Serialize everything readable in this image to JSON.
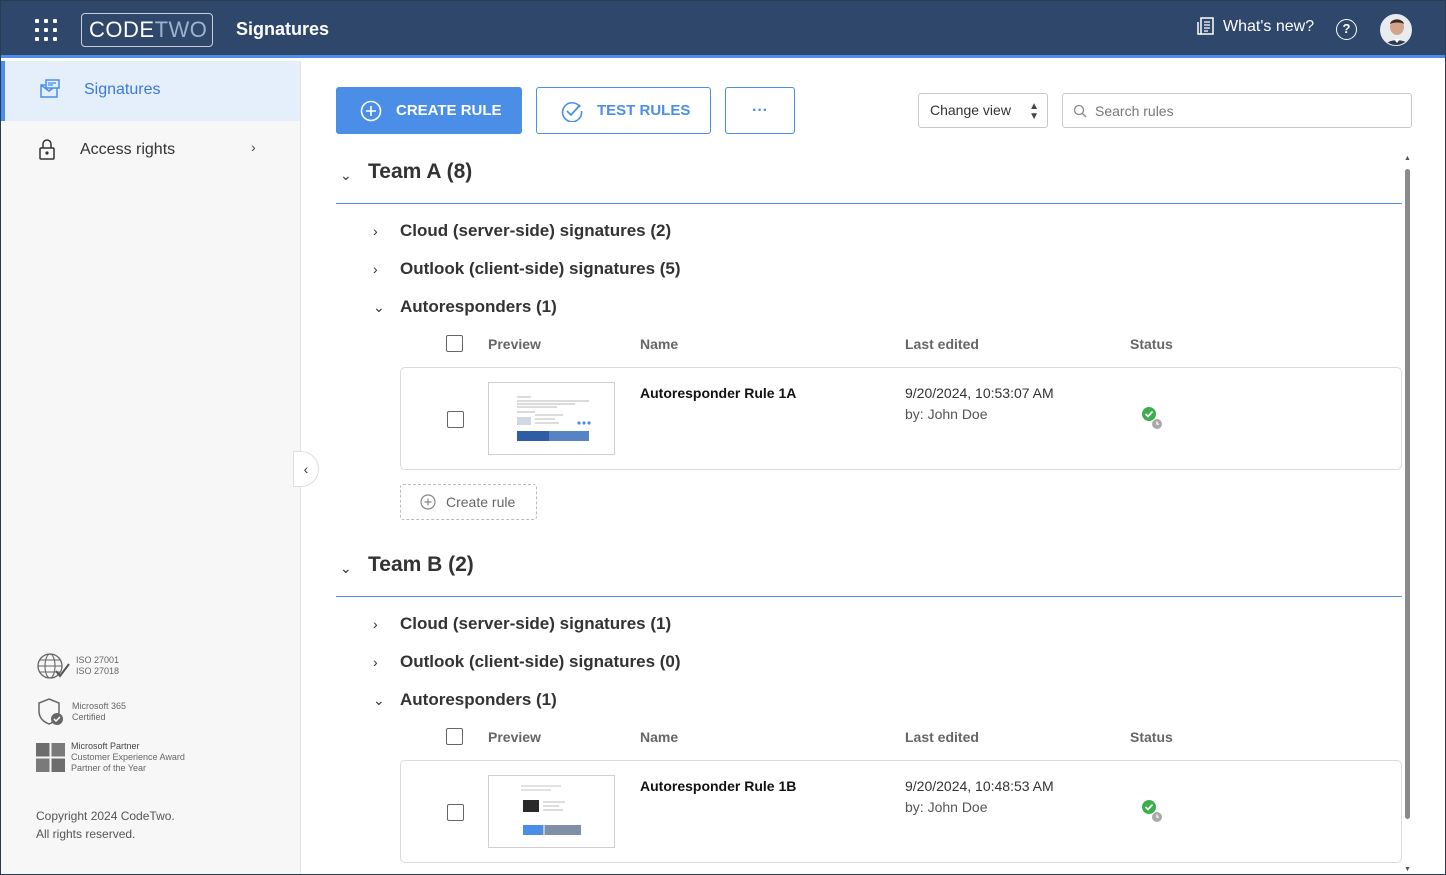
{
  "header": {
    "logo": {
      "code": "CODE",
      "two": "TWO"
    },
    "app_title": "Signatures",
    "whats_new": "What's new?",
    "help": "?"
  },
  "sidebar": {
    "items": [
      {
        "label": "Signatures",
        "icon": "signature-envelope-icon",
        "active": true
      },
      {
        "label": "Access rights",
        "icon": "lock-icon",
        "active": false
      }
    ],
    "certs": [
      {
        "lines": [
          "ISO 27001",
          "ISO 27018"
        ],
        "icon": "globe-check-icon"
      },
      {
        "lines": [
          "Microsoft 365",
          "Certified"
        ],
        "icon": "shield-check-icon"
      },
      {
        "lines": [
          "Microsoft Partner",
          "Customer Experience Award",
          "Partner of the Year"
        ],
        "icon": "microsoft-logo-icon"
      }
    ],
    "copyright": [
      "Copyright 2024 CodeTwo.",
      "All rights reserved."
    ]
  },
  "toolbar": {
    "create_rule": "CREATE RULE",
    "test_rules": "TEST RULES",
    "more": "···",
    "change_view": "Change view",
    "search_placeholder": "Search rules"
  },
  "columns": {
    "preview": "Preview",
    "name": "Name",
    "last_edited": "Last edited",
    "status": "Status"
  },
  "teams": [
    {
      "title": "Team A (8)",
      "categories": [
        {
          "label": "Cloud (server-side) signatures (2)",
          "expanded": false
        },
        {
          "label": "Outlook (client-side) signatures (5)",
          "expanded": false
        },
        {
          "label": "Autoresponders (1)",
          "expanded": true
        }
      ],
      "rules": [
        {
          "name": "Autoresponder Rule 1A",
          "edited": "9/20/2024, 10:53:07 AM",
          "by": "by: John Doe",
          "status": "active-scheduled"
        }
      ],
      "create_rule": "Create rule"
    },
    {
      "title": "Team B (2)",
      "categories": [
        {
          "label": "Cloud (server-side) signatures (1)",
          "expanded": false
        },
        {
          "label": "Outlook (client-side) signatures (0)",
          "expanded": false
        },
        {
          "label": "Autoresponders (1)",
          "expanded": true
        }
      ],
      "rules": [
        {
          "name": "Autoresponder Rule 1B",
          "edited": "9/20/2024, 10:48:53 AM",
          "by": "by: John Doe",
          "status": "active-scheduled"
        }
      ]
    }
  ],
  "colors": {
    "accent": "#4a8ee8",
    "header": "#2e476b",
    "status_ok": "#3cae4d"
  }
}
